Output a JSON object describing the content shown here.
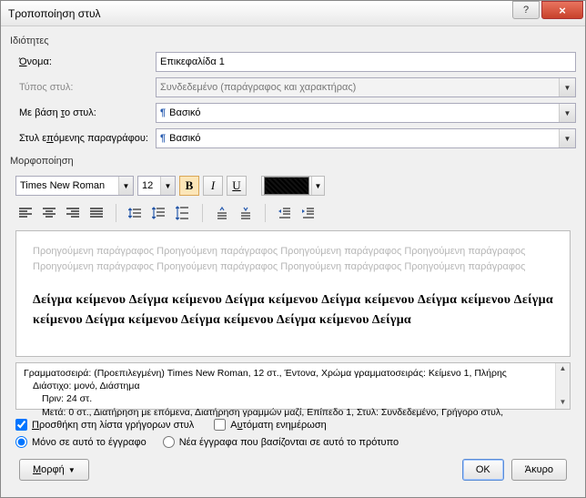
{
  "title": "Τροποποίηση στυλ",
  "properties_label": "Ιδιότητες",
  "labels": {
    "name": "Όνομα:",
    "style_type": "Τύπος στυλ:",
    "based_on": "Με βάση το στυλ:",
    "next_para": "Στυλ επόμενης παραγράφου:"
  },
  "values": {
    "name": "Επικεφαλίδα 1",
    "style_type": "Συνδεδεμένο (παράγραφος και χαρακτήρας)",
    "based_on": "Βασικό",
    "next_para": "Βασικό"
  },
  "formatting_label": "Μορφοποίηση",
  "font": {
    "family": "Times New Roman",
    "size": "12"
  },
  "preview": {
    "previous": "Προηγούμενη παράγραφος Προηγούμενη παράγραφος Προηγούμενη παράγραφος Προηγούμενη παράγραφος Προηγούμενη παράγραφος Προηγούμενη παράγραφος Προηγούμενη παράγραφος Προηγούμενη παράγραφος",
    "sample": "Δείγμα κείμενου Δείγμα κείμενου Δείγμα κείμενου Δείγμα κείμενου Δείγμα κείμενου Δείγμα κείμενου Δείγμα κείμενου Δείγμα κείμενου Δείγμα κείμενου Δείγμα"
  },
  "description": {
    "line1": "Γραμματοσειρά: (Προεπιλεγμένη) Times New Roman, 12 στ., Έντονα, Χρώμα γραμματοσειράς: Κείμενο 1, Πλήρης",
    "line2": "Διάστιχο:  μονό, Διάστημα",
    "line3": "Πριν:  24 στ.",
    "line4": "Μετά:  0 στ., Διατήρηση με επόμενα, Διατήρηση γραμμών μαζί, Επίπεδο 1, Στυλ: Συνδεδεμένο, Γρήγορο στυλ,"
  },
  "checks": {
    "add_quick": "Προσθήκη στη λίστα γρήγορων στυλ",
    "auto_update": "Αυτόματη ενημέρωση"
  },
  "radios": {
    "this_doc": "Μόνο σε αυτό το έγγραφο",
    "new_docs": "Νέα έγγραφα που βασίζονται σε αυτό το πρότυπο"
  },
  "buttons": {
    "format": "Μορφή",
    "ok": "OK",
    "cancel": "Άκυρο"
  }
}
